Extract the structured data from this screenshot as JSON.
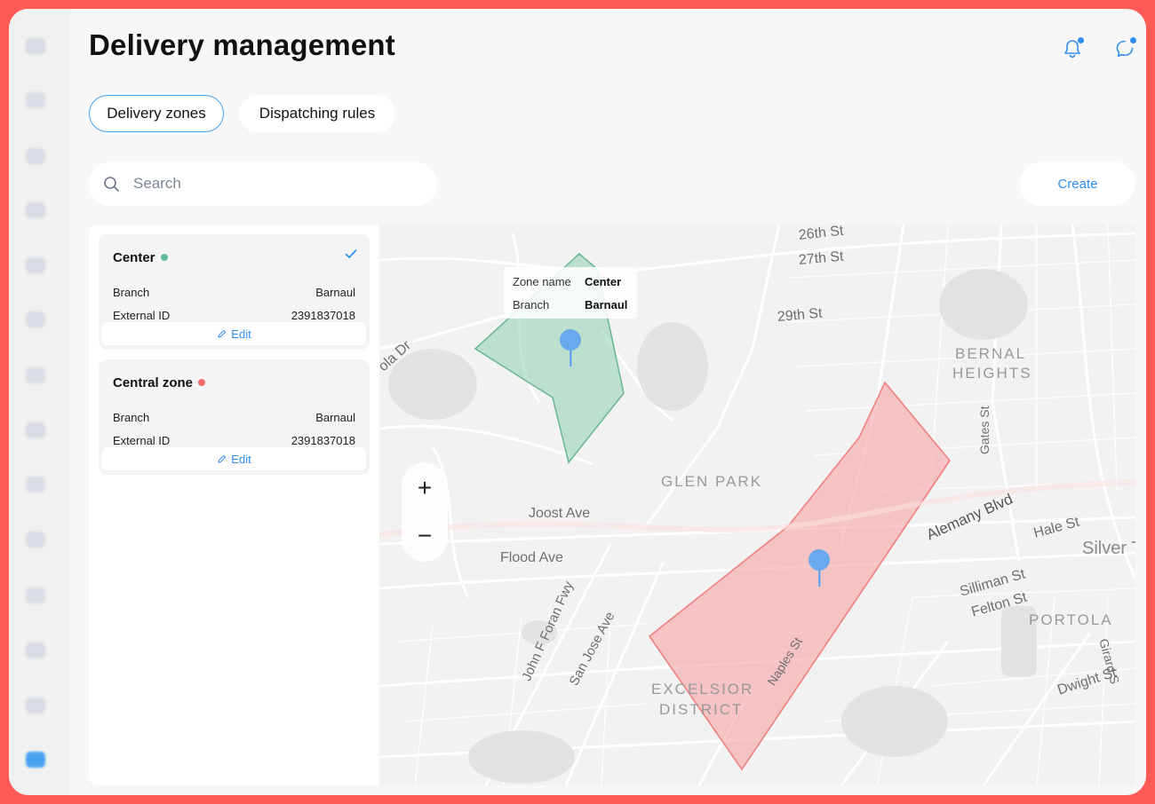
{
  "page": {
    "title": "Delivery management"
  },
  "header_icons": [
    "bell-icon",
    "chat-icon"
  ],
  "tabs": [
    {
      "label": "Delivery zones",
      "active": true
    },
    {
      "label": "Dispatching rules",
      "active": false
    }
  ],
  "search": {
    "placeholder": "Search"
  },
  "create_label": "Create",
  "zones": [
    {
      "name": "Center",
      "status_color": "#5fbf98",
      "selected": true,
      "branch_label": "Branch",
      "branch": "Barnaul",
      "external_id_label": "External ID",
      "external_id": "2391837018",
      "edit_label": "Edit"
    },
    {
      "name": "Central zone",
      "status_color": "#f26b6b",
      "selected": false,
      "branch_label": "Branch",
      "branch": "Barnaul",
      "external_id_label": "External ID",
      "external_id": "2391837018",
      "edit_label": "Edit"
    }
  ],
  "map": {
    "tooltip": {
      "zone_name_label": "Zone name",
      "zone_name": "Center",
      "branch_label": "Branch",
      "branch": "Barnaul"
    },
    "zoom_in": "+",
    "zoom_out": "−",
    "labels": {
      "st26": "26th St",
      "st27": "27th St",
      "st29": "29th St",
      "bernal1": "BERNAL",
      "bernal2": "HEIGHTS",
      "gates": "Gates St",
      "glen_park": "GLEN PARK",
      "joost": "Joost Ave",
      "flood": "Flood Ave",
      "alemany": "Alemany Blvd",
      "hale": "Hale St",
      "silver": "Silver Te",
      "silliman": "Silliman St",
      "felton": "Felton St",
      "portola": "PORTOLA",
      "girard": "Girard S",
      "dwight": "Dwight St",
      "naples": "Naples St",
      "excelsior": "EXCELSIOR",
      "district": "DISTRICT",
      "jf_foran": "John F Foran Fwy",
      "san_jose": "San Jose Ave",
      "ola": "ola Dr"
    },
    "zone_colors": {
      "green_fill": "#8fcfb1",
      "green_stroke": "#6fb897",
      "red_fill": "#f7a3a3",
      "red_stroke": "#f08080",
      "pin": "#6aa9ec"
    }
  }
}
